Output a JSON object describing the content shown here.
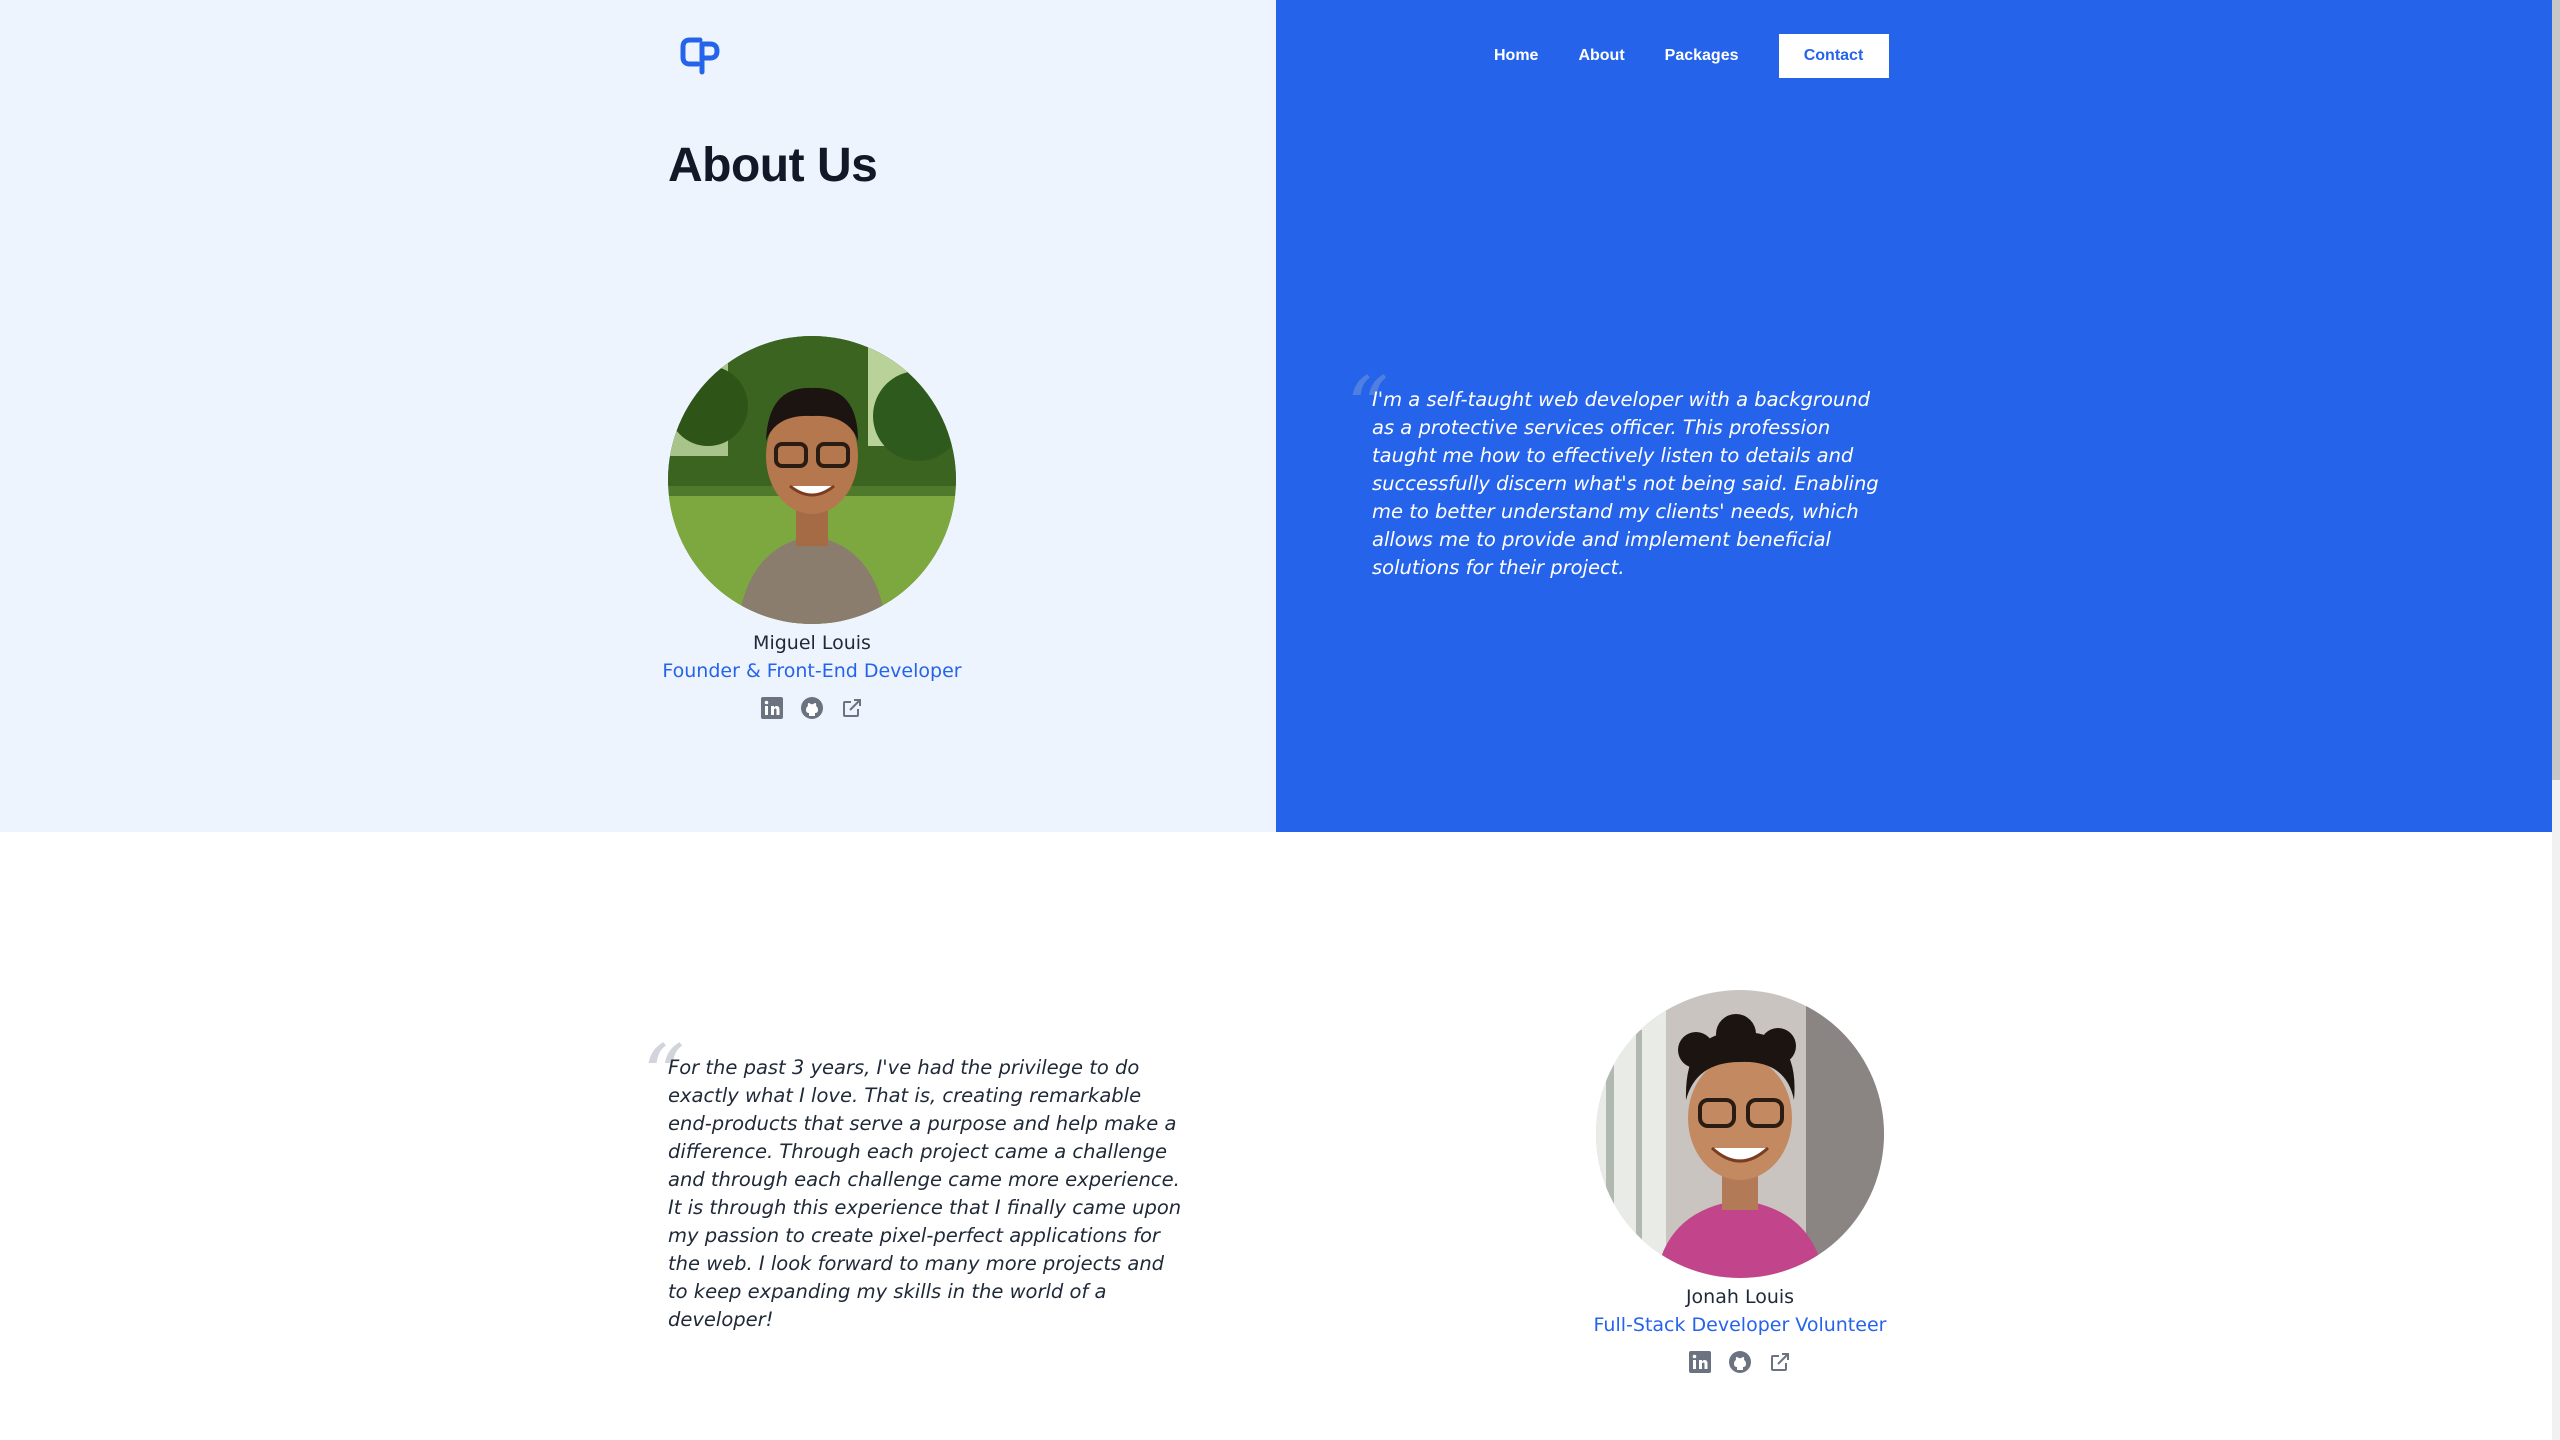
{
  "nav": {
    "items": [
      {
        "label": "Home"
      },
      {
        "label": "About"
      },
      {
        "label": "Packages"
      }
    ],
    "contact_label": "Contact"
  },
  "logo": {
    "icon": "cp-logo-icon",
    "color": "#2563eb"
  },
  "page": {
    "title": "About Us"
  },
  "team": [
    {
      "name": "Miguel Louis",
      "role": "Founder & Front-End Developer",
      "quote": "I'm a self-taught web developer with a background as a protective services officer. This profession taught me how to effectively listen to details and successfully discern what's not being said. Enabling me to better understand my clients' needs, which allows me to provide and implement beneficial solutions for their project.",
      "socials": [
        "linkedin-icon",
        "github-icon",
        "external-link-icon"
      ]
    },
    {
      "name": "Jonah Louis",
      "role": "Full-Stack Developer Volunteer",
      "quote": "For the past 3 years, I've had the privilege to do exactly what I love. That is, creating remarkable end-products that serve a purpose and help make a difference. Through each project came a challenge and through each challenge came more experience. It is through this experience that I finally came upon my passion to create pixel-perfect applications for the web. I look forward to many more projects and to keep expanding my skills in the world of a developer!",
      "socials": [
        "linkedin-icon",
        "github-icon",
        "external-link-icon"
      ]
    }
  ],
  "colors": {
    "brand_blue": "#2563eb",
    "light_panel": "#eef4fd",
    "heading": "#111827",
    "icon_gray": "#6b7280"
  }
}
